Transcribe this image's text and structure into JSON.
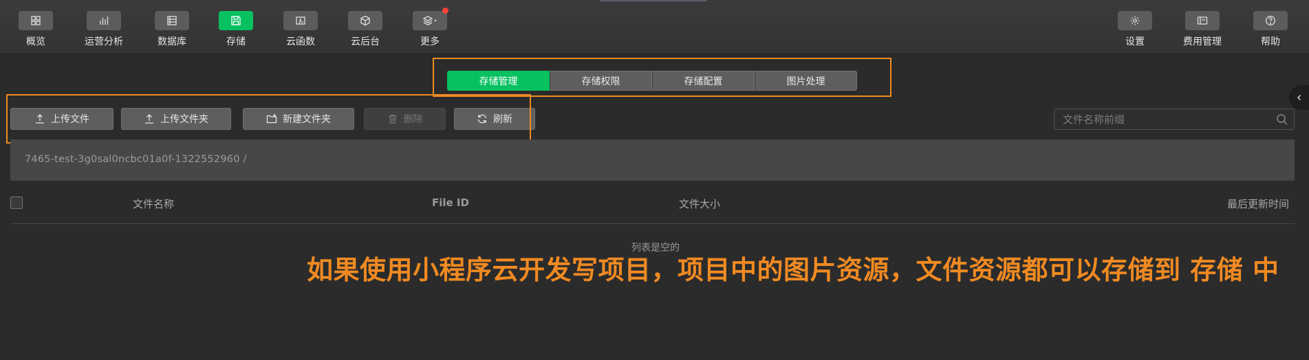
{
  "toolbar": {
    "left": [
      {
        "label": "概览",
        "icon": "grid-icon"
      },
      {
        "label": "运营分析",
        "icon": "bar-chart-icon"
      },
      {
        "label": "数据库",
        "icon": "database-icon"
      },
      {
        "label": "存储",
        "icon": "save-icon",
        "active": true
      },
      {
        "label": "云函数",
        "icon": "function-icon"
      },
      {
        "label": "云后台",
        "icon": "cube-icon"
      },
      {
        "label": "更多",
        "icon": "layers-icon"
      }
    ],
    "right": [
      {
        "label": "设置",
        "icon": "gear-icon"
      },
      {
        "label": "费用管理",
        "icon": "billing-icon"
      },
      {
        "label": "帮助",
        "icon": "help-icon"
      }
    ]
  },
  "tabs": [
    "存储管理",
    "存储权限",
    "存储配置",
    "图片处理"
  ],
  "actions": {
    "upload_file": "上传文件",
    "upload_folder": "上传文件夹",
    "new_folder": "新建文件夹",
    "delete": "删除",
    "refresh": "刷新"
  },
  "search": {
    "placeholder": "文件名称前缀"
  },
  "path": "7465-test-3g0sal0ncbc01a0f-1322552960 /",
  "table": {
    "columns": [
      "文件名称",
      "File ID",
      "文件大小",
      "最后更新时间"
    ],
    "empty_text": "列表是空的"
  },
  "annotation": "如果使用小程序云开发写项目，项目中的图片资源，文件资源都可以存储到 存储 中",
  "colors": {
    "accent": "#07c160",
    "annotation": "#f08a22",
    "background": "#2b2b2b"
  }
}
